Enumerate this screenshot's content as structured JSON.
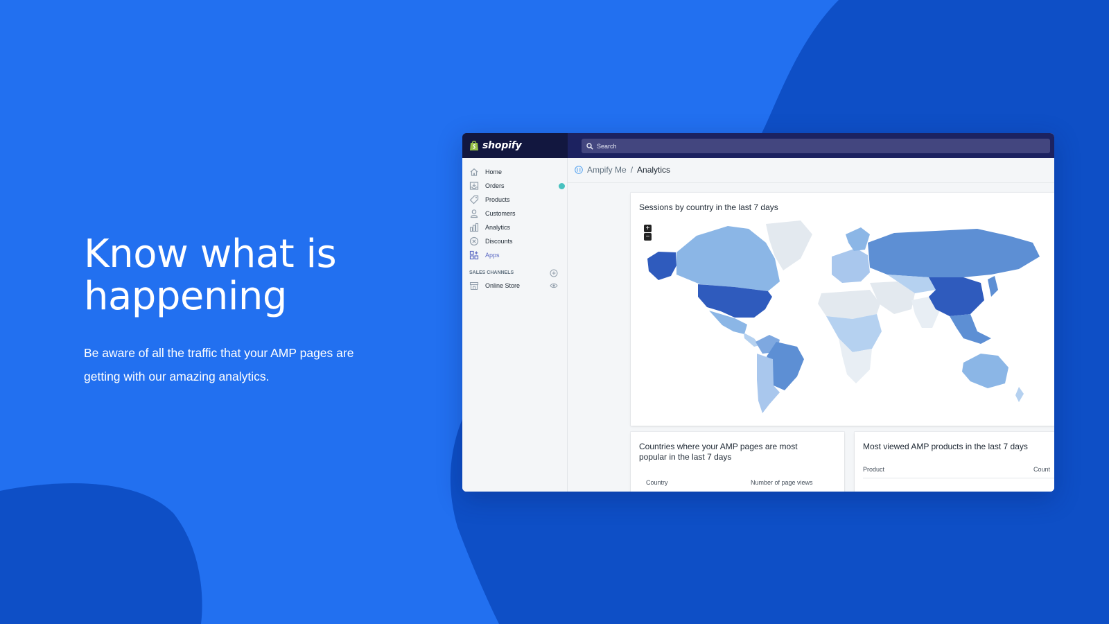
{
  "hero": {
    "title_line1": "Know what is",
    "title_line2": "happening",
    "subtitle_line1": "Be aware of all the traffic that your AMP pages are",
    "subtitle_line2": "getting with our amazing analytics."
  },
  "colors": {
    "background": "#2270f0",
    "background_dark": "#0d4fc4",
    "topbar": "#1c2260",
    "accent": "#5c6ac4",
    "badge": "#47c1bf"
  },
  "app": {
    "logo_text": "shopify",
    "search_placeholder": "Search",
    "nav": [
      {
        "label": "Home",
        "icon": "home-icon"
      },
      {
        "label": "Orders",
        "icon": "orders-icon"
      },
      {
        "label": "Products",
        "icon": "tag-icon"
      },
      {
        "label": "Customers",
        "icon": "person-icon"
      },
      {
        "label": "Analytics",
        "icon": "bar-chart-icon"
      },
      {
        "label": "Discounts",
        "icon": "discount-icon"
      },
      {
        "label": "Apps",
        "icon": "apps-icon"
      }
    ],
    "sales_channels_heading": "SALES CHANNELS",
    "online_store_label": "Online Store",
    "breadcrumb": {
      "app": "Ampify Me",
      "separator": "/",
      "current": "Analytics"
    },
    "map_card": {
      "title": "Sessions by country in the last 7 days",
      "zoom_in": "+",
      "zoom_out": "−"
    },
    "countries_card": {
      "title_line1": "Countries where your AMP pages are most",
      "title_line2": "popular in the last 7 days",
      "col_country": "Country",
      "col_views": "Number of page views"
    },
    "products_card": {
      "title": "Most viewed AMP products in the last 7 days",
      "col_product": "Product",
      "col_count": "Count"
    }
  }
}
